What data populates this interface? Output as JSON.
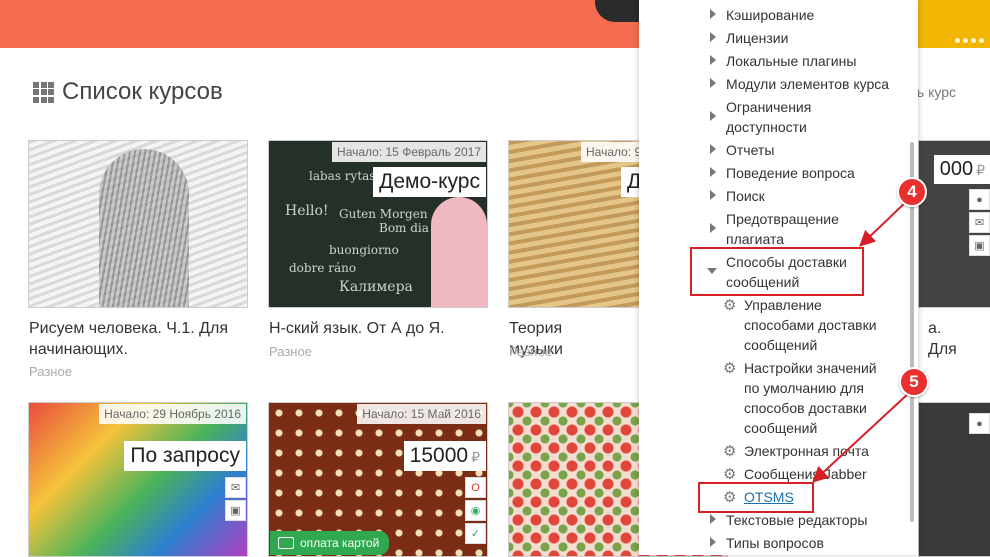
{
  "page": {
    "title": "Список курсов",
    "sort_link": "ать курс"
  },
  "colors": {
    "banner": "#f36c4f",
    "annotation": "#d71f26",
    "link": "#1a6faf"
  },
  "courses": [
    {
      "title": "Рисуем человека. Ч.1. Для начинающих.",
      "category": "Разное"
    },
    {
      "title": "Н-ский язык. От А до Я.",
      "category": "Разное",
      "start": "Начало: 15 Февраль 2017",
      "tag": "Демо-курс",
      "chalk": [
        "labas rytas",
        "Hello!",
        "Guten Morgen",
        "Bom dia",
        "buongiorno",
        "dobre ráno",
        "Калимера"
      ]
    },
    {
      "title": "Теория музыки",
      "category": "Разное",
      "start": "Начало: 9",
      "tag": "Д"
    },
    {
      "title": "а. Для",
      "price": "000",
      "currency": "₽"
    },
    {
      "start": "Начало: 29 Ноябрь 2016",
      "tag": "По запросу"
    },
    {
      "start": "Начало: 15 Май 2016",
      "price": "15000",
      "currency": "₽",
      "pay_label": "оплата картой"
    },
    {},
    {}
  ],
  "tree": {
    "items": [
      {
        "label": "Кэширование",
        "kind": "collapsed"
      },
      {
        "label": "Лицензии",
        "kind": "collapsed"
      },
      {
        "label": "Локальные плагины",
        "kind": "collapsed"
      },
      {
        "label": "Модули элементов курса",
        "kind": "collapsed"
      },
      {
        "label": "Ограничения доступности",
        "kind": "collapsed"
      },
      {
        "label": "Отчеты",
        "kind": "collapsed"
      },
      {
        "label": "Поведение вопроса",
        "kind": "collapsed"
      },
      {
        "label": "Поиск",
        "kind": "collapsed"
      },
      {
        "label": "Предотвращение плагиата",
        "kind": "collapsed"
      },
      {
        "label": "Способы доставки сообщений",
        "kind": "expanded"
      },
      {
        "label": "Управление способами доставки сообщений",
        "kind": "setting"
      },
      {
        "label": "Настройки значений по умолчанию для способов доставки сообщений",
        "kind": "setting"
      },
      {
        "label": "Электронная почта",
        "kind": "setting"
      },
      {
        "label": "Сообщения Jabber",
        "kind": "setting"
      },
      {
        "label": "OTSMS",
        "kind": "setting-link"
      },
      {
        "label": "Текстовые редакторы",
        "kind": "collapsed"
      },
      {
        "label": "Типы вопросов",
        "kind": "collapsed"
      }
    ]
  },
  "annotations": {
    "step4": "4",
    "step5": "5"
  }
}
